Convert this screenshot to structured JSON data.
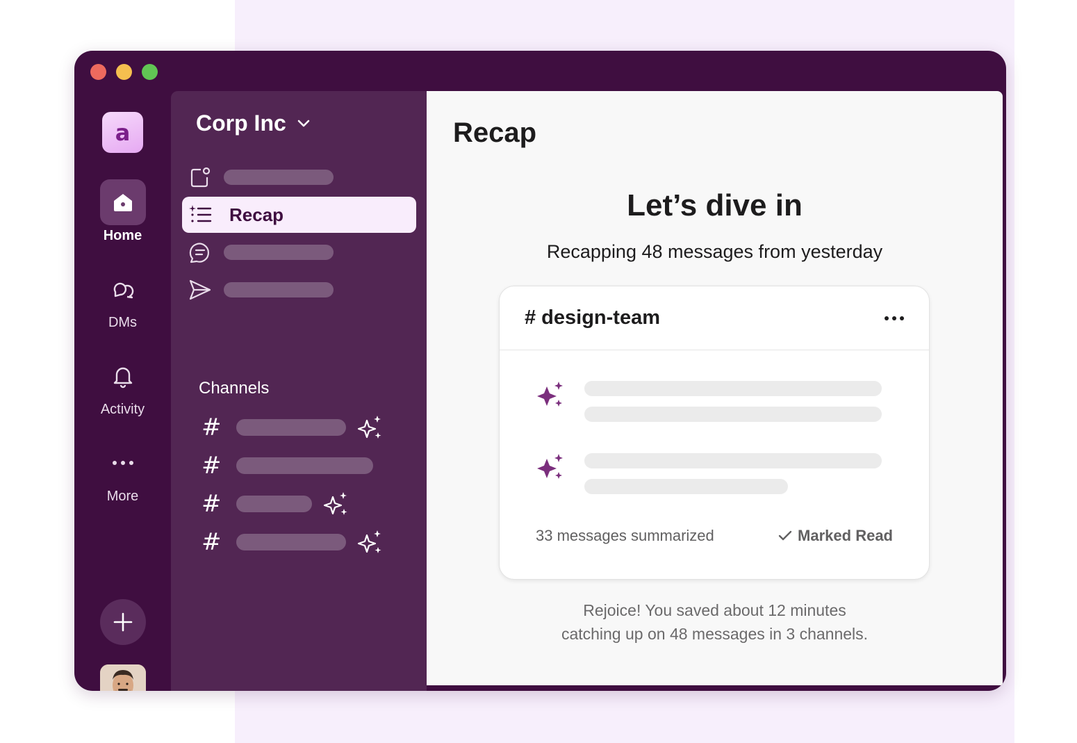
{
  "workspace": {
    "logo_letter": "a",
    "name": "Corp Inc"
  },
  "rail": {
    "items": [
      {
        "label": "Home",
        "icon": "home-icon",
        "active": true
      },
      {
        "label": "DMs",
        "icon": "dms-icon",
        "active": false
      },
      {
        "label": "Activity",
        "icon": "bell-icon",
        "active": false
      },
      {
        "label": "More",
        "icon": "more-icon",
        "active": false
      }
    ],
    "add_icon": "plus-icon"
  },
  "sidebar": {
    "nav": [
      {
        "icon": "unreads-icon"
      },
      {
        "icon": "recap-icon",
        "label": "Recap",
        "selected": true
      },
      {
        "icon": "threads-icon"
      },
      {
        "icon": "send-icon"
      }
    ],
    "channels_title": "Channels",
    "channel_icon": "#"
  },
  "main": {
    "title": "Recap",
    "headline": "Let’s dive in",
    "subline": "Recapping 48 messages from yesterday",
    "card": {
      "channel": "# design-team",
      "messages_summarized": "33 messages summarized",
      "marked_read": "Marked Read"
    },
    "saved_line1": "Rejoice! You saved about 12 minutes",
    "saved_line2": "catching up on 48 messages in 3 channels."
  },
  "colors": {
    "aubergine": "#3f0e40",
    "sidebar": "#522653",
    "accent_sparkle": "#7b2f7d",
    "presence": "#2bac76"
  }
}
